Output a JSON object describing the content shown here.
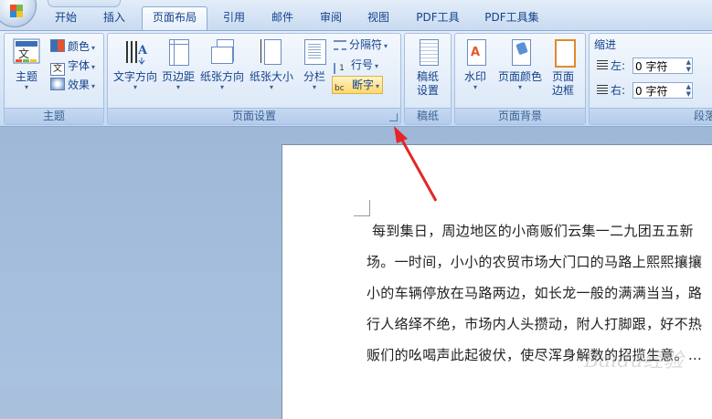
{
  "tabs": [
    "开始",
    "插入",
    "页面布局",
    "引用",
    "邮件",
    "审阅",
    "视图",
    "PDF工具",
    "PDF工具集"
  ],
  "active_tab": "页面布局",
  "groups": {
    "theme": {
      "label": "主题",
      "theme_button": "主题",
      "colors": "颜色",
      "fonts": "字体",
      "effects": "效果"
    },
    "page_setup": {
      "label": "页面设置",
      "text_direction": "文字方向",
      "margins": "页边距",
      "orientation": "纸张方向",
      "size": "纸张大小",
      "columns": "分栏",
      "breaks": "分隔符",
      "line_numbers": "行号",
      "hyphenation": "断字"
    },
    "draft": {
      "label": "稿纸",
      "draft_settings_line1": "稿纸",
      "draft_settings_line2": "设置"
    },
    "page_background": {
      "label": "页面背景",
      "watermark": "水印",
      "page_color": "页面颜色",
      "page_borders_line1": "页面",
      "page_borders_line2": "边框"
    },
    "paragraph": {
      "label": "段落",
      "indent": "缩进",
      "left_label": "左:",
      "left_value": "0 字符",
      "right_label": "右:",
      "right_value": "0 字符"
    }
  },
  "document": {
    "lines": [
      "每到集日，周边地区的小商贩们云集一二九团五五新",
      "场。一时间，小小的农贸市场大门口的马路上熙熙攘攘",
      "小的车辆停放在马路两边，如长龙一般的满满当当，路",
      "行人络绎不绝，市场内人头攒动，附人打脚跟，好不热",
      "贩们的吆喝声此起彼伏，使尽浑身解数的招揽生意。…"
    ],
    "watermark_text": "Baidu经验"
  },
  "colors": {
    "arrow": "#e3262a",
    "ribbon_text": "#15428b"
  }
}
